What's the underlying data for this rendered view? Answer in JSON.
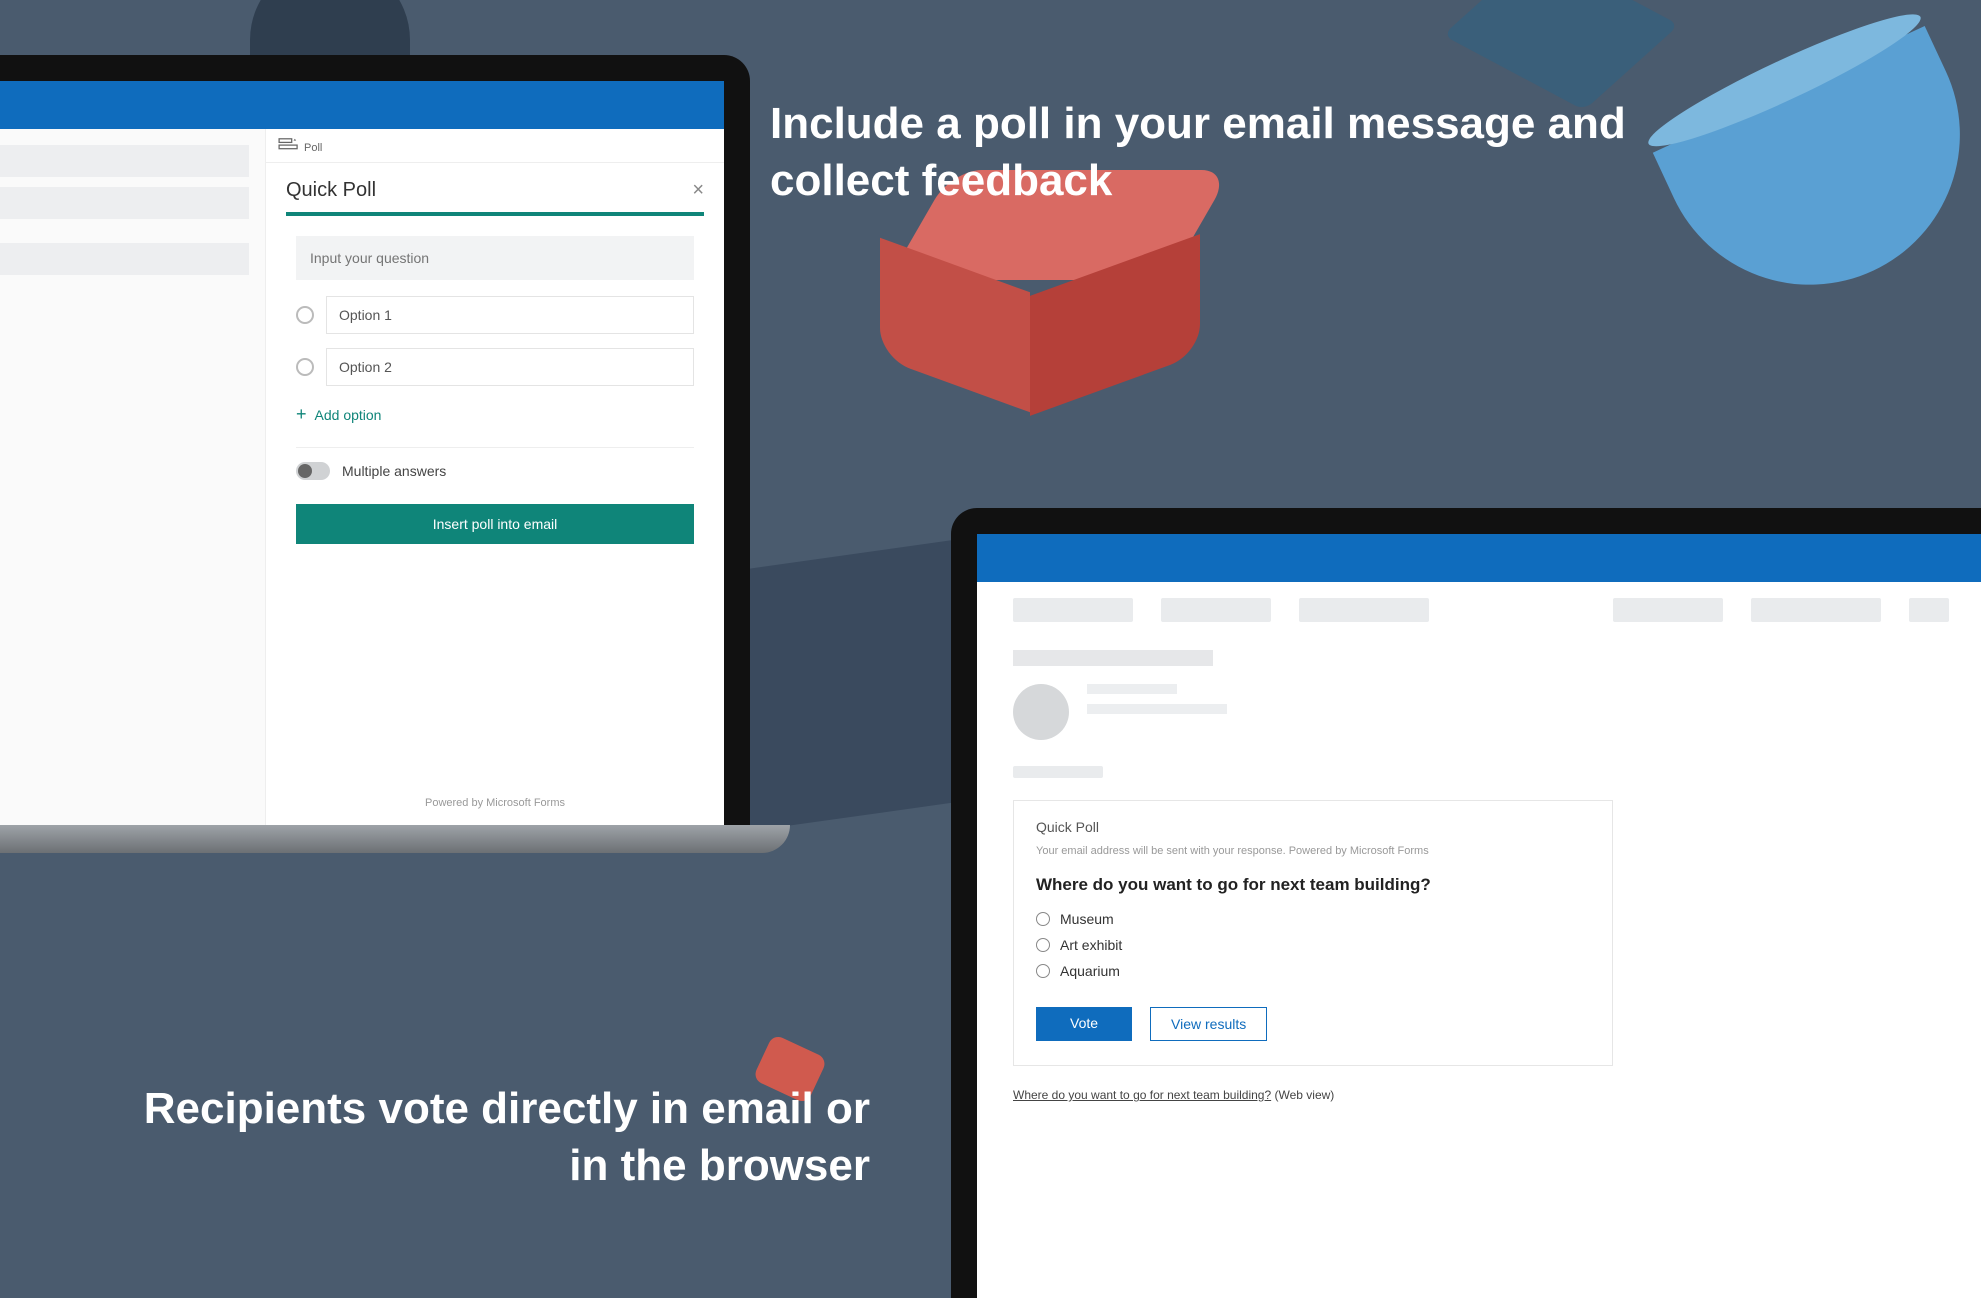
{
  "marketing": {
    "headline1": "Include a poll in your email message and collect feedback",
    "headline2": "Recipients vote directly in email or in the browser"
  },
  "colors": {
    "outlook_blue": "#0f6cbd",
    "teal": "#0f8579"
  },
  "screen1": {
    "poll_icon_label": "Poll",
    "panel_title": "Quick Poll",
    "question_placeholder": "Input your question",
    "options": [
      "Option 1",
      "Option 2"
    ],
    "add_option_label": "Add option",
    "multiple_answers_label": "Multiple answers",
    "insert_button": "Insert poll into email",
    "powered_by": "Powered by Microsoft Forms"
  },
  "screen2": {
    "card_title": "Quick Poll",
    "disclaimer": "Your email address will be sent with your response. Powered by Microsoft Forms",
    "question": "Where do you want to go for next team building?",
    "choices": [
      "Museum",
      "Art exhibit",
      "Aquarium"
    ],
    "vote_label": "Vote",
    "view_results_label": "View results",
    "webview_text": "Where do you want to go for next team building?",
    "webview_suffix": " (Web view)"
  }
}
